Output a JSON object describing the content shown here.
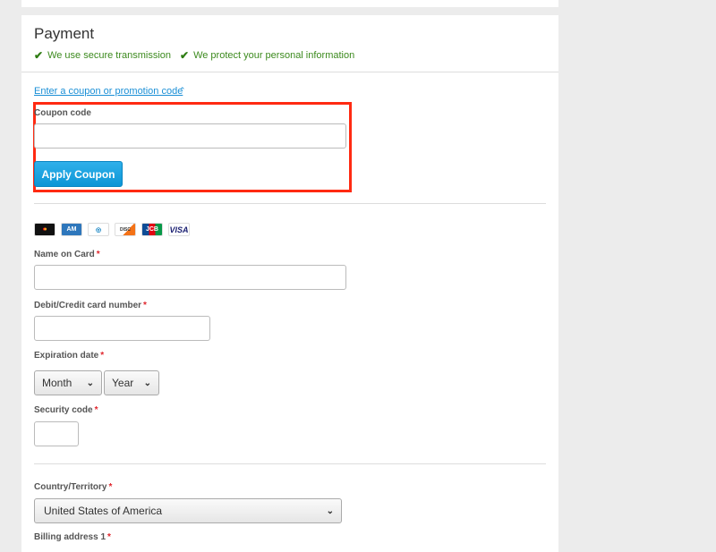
{
  "header": {
    "title": "Payment",
    "assurances": [
      "We use secure transmission",
      "We protect your personal information"
    ]
  },
  "coupon": {
    "toggle_link": "Enter a coupon or promotion code",
    "label": "Coupon code",
    "value": "",
    "apply_label": "Apply Coupon",
    "highlight_color": "#ff2a12"
  },
  "card_brands": [
    "Mastercard",
    "American Express",
    "Diners Club",
    "Discover",
    "JCB",
    "VISA"
  ],
  "fields": {
    "name_label": "Name on Card",
    "card_number_label": "Debit/Credit card number",
    "expiration_label": "Expiration date",
    "month": "Month",
    "year": "Year",
    "security_label": "Security code",
    "country_label": "Country/Territory",
    "country": "United States of America",
    "billing_label": "Billing address 1",
    "required_mark": "*"
  },
  "colors": {
    "accent": "#1a8fd6",
    "button": "#0d96d6",
    "success": "#3c8a1e",
    "required": "#e0262d"
  }
}
